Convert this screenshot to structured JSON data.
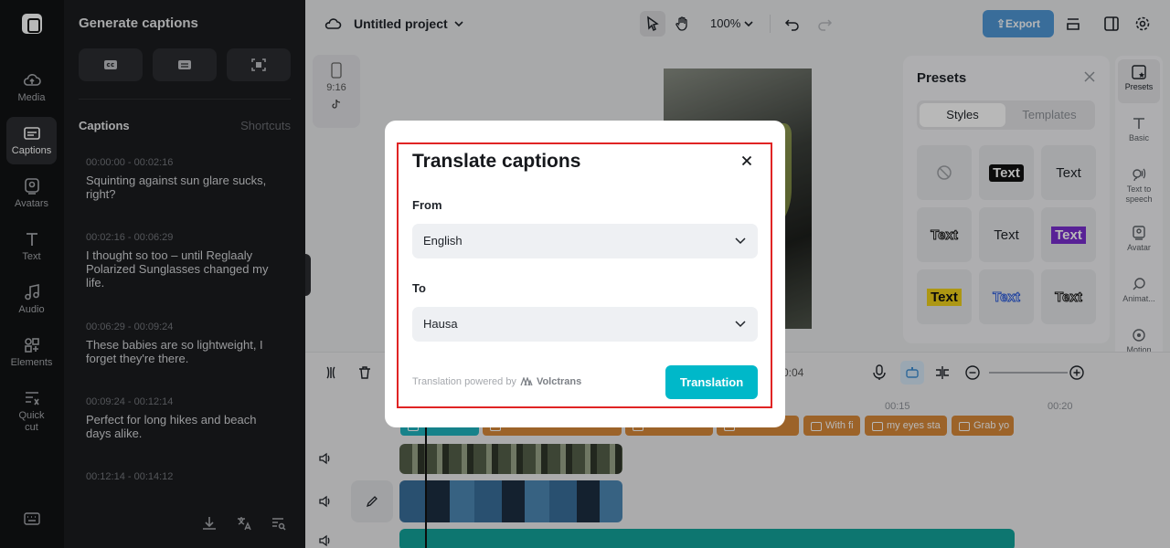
{
  "rail": {
    "items": [
      {
        "label": "Media",
        "icon": "cloud-upload-icon"
      },
      {
        "label": "Captions",
        "icon": "captions-icon"
      },
      {
        "label": "Avatars",
        "icon": "avatar-icon"
      },
      {
        "label": "Text",
        "icon": "text-icon"
      },
      {
        "label": "Audio",
        "icon": "music-icon"
      },
      {
        "label": "Elements",
        "icon": "elements-icon"
      },
      {
        "label": "Quick\ncut",
        "icon": "quick-cut-icon"
      }
    ]
  },
  "panel": {
    "title": "Generate captions",
    "section": "Captions",
    "shortcuts": "Shortcuts",
    "captions": [
      {
        "time": "00:00:00 - 00:02:16",
        "text": "Squinting against sun glare sucks, right?"
      },
      {
        "time": "00:02:16 - 00:06:29",
        "text": "I thought so too – until Reglaaly Polarized Sunglasses changed my life."
      },
      {
        "time": "00:06:29 - 00:09:24",
        "text": "These babies are so lightweight, I forget they're there."
      },
      {
        "time": "00:09:24 - 00:12:14",
        "text": "Perfect for long hikes and beach days alike."
      },
      {
        "time": "00:12:14 - 00:14:12",
        "text": ""
      }
    ]
  },
  "topbar": {
    "project": "Untitled project",
    "zoom": "100%",
    "export": "Export"
  },
  "canvas": {
    "ratio": "9:16"
  },
  "presets": {
    "title": "Presets",
    "tabs": [
      "Styles",
      "Templates"
    ],
    "tiles": [
      "",
      "Text",
      "Text",
      "Text",
      "Text",
      "Text",
      "Text",
      "Text",
      "Text"
    ]
  },
  "right_rail": {
    "items": [
      "Presets",
      "Basic",
      "Text to speech",
      "Avatar",
      "Animat...",
      "Motion tracking"
    ]
  },
  "timeline": {
    "time": "0:04",
    "ruler": [
      "00:15",
      "00:20"
    ],
    "caption_chips": [
      "With fi",
      "my eyes sta",
      "Grab yo"
    ]
  },
  "modal": {
    "title": "Translate captions",
    "from_label": "From",
    "from_value": "English",
    "to_label": "To",
    "to_value": "Hausa",
    "powered_by": "Translation powered by",
    "brand": "Volctrans",
    "button": "Translation"
  }
}
